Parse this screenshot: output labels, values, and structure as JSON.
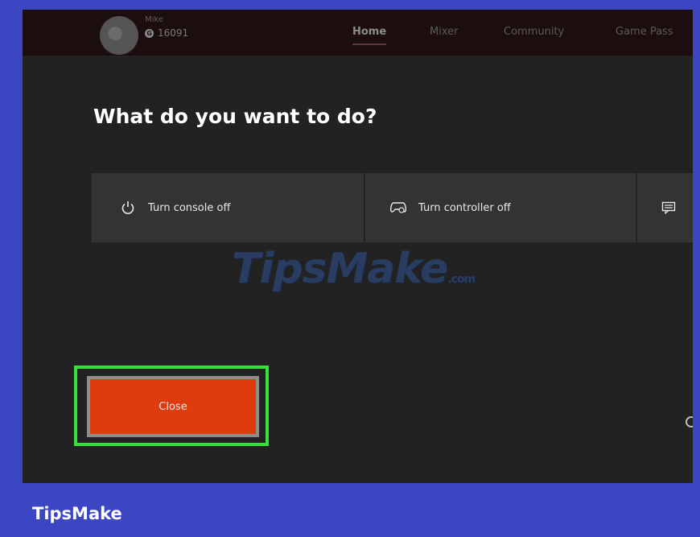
{
  "user": {
    "gamertag": "Mike",
    "gamerscore": "16091"
  },
  "nav": {
    "home": "Home",
    "mixer": "Mixer",
    "community": "Community",
    "game_pass": "Game Pass"
  },
  "dialog": {
    "heading": "What do you want to do?",
    "options": [
      {
        "label": "Turn console off",
        "icon": "power-icon"
      },
      {
        "label": "Turn controller off",
        "icon": "controller-icon"
      },
      {
        "label": "",
        "icon": "message-icon"
      }
    ],
    "close_label": "Close"
  },
  "watermark": {
    "text": "TipsMake",
    "suffix": ".com"
  },
  "brand": {
    "label": "TipsMake"
  },
  "colors": {
    "close_button": "#de3b0e",
    "highlight": "#34e33c",
    "frame": "#3d46c2",
    "screen_bg": "#222222"
  }
}
